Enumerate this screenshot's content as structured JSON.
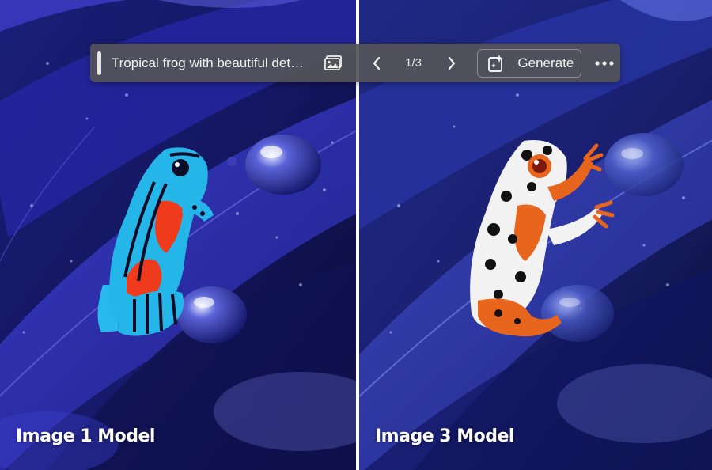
{
  "toolbar": {
    "prompt_text": "Tropical frog with beautiful detail...",
    "image_icon": "image-icon",
    "prev_icon": "chevron-left-icon",
    "counter": "1/3",
    "next_icon": "chevron-right-icon",
    "generate_icon": "sparkle-generate-icon",
    "generate_label": "Generate",
    "more_icon": "more-horizontal-icon"
  },
  "panels": {
    "left_caption": "Image 1 Model",
    "right_caption": "Image 3 Model"
  },
  "colors": {
    "toolbar_bg": "#545458",
    "leaf_blue": "#2b2ca8",
    "frog_left": "#23b5e6",
    "frog_right": "#e8651e"
  }
}
